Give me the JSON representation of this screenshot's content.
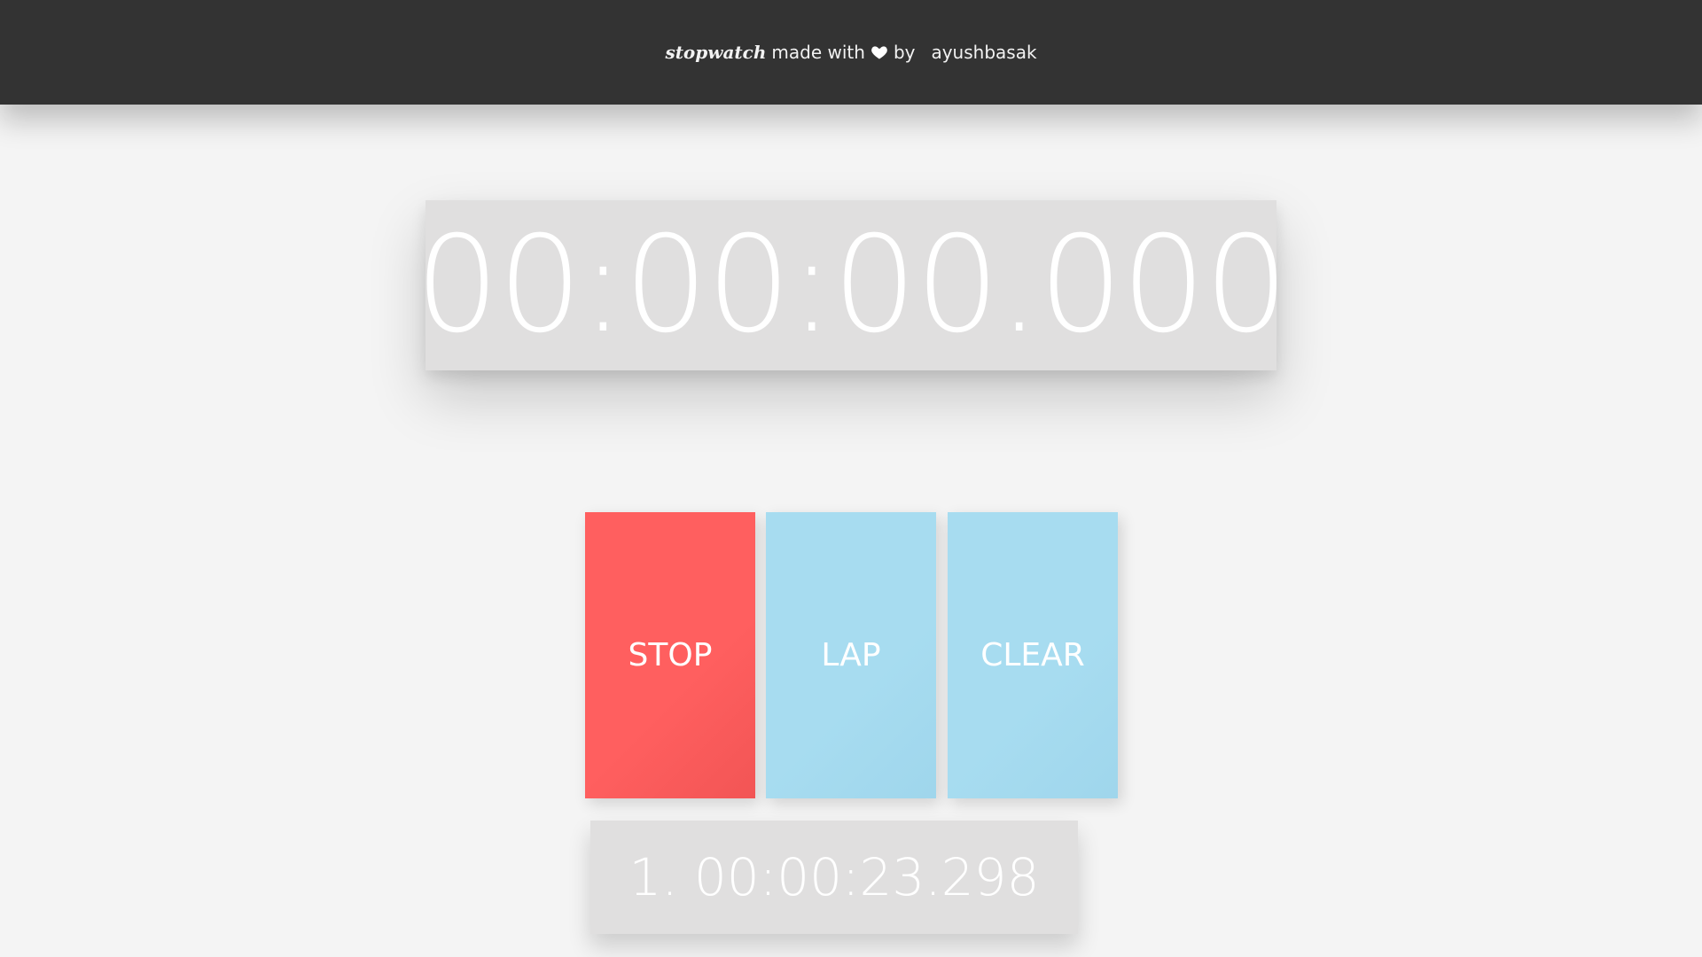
{
  "header": {
    "brand": "stopwatch",
    "made_with": "made with",
    "heart_icon": "heart-icon",
    "by": "by",
    "author": "ayushbasak"
  },
  "timer": {
    "display": "00:00:00.000"
  },
  "controls": {
    "stop_label": "STOP",
    "lap_label": "LAP",
    "clear_label": "CLEAR"
  },
  "laps": [
    {
      "index": "1.",
      "time": "00:00:23.298"
    }
  ],
  "colors": {
    "header_bg": "#333333",
    "page_bg": "#f4f4f4",
    "stop": "#ff5f5f",
    "lap": "#a7dcf0",
    "clear": "#a7dcf0",
    "panel": "#e0dfdf"
  }
}
